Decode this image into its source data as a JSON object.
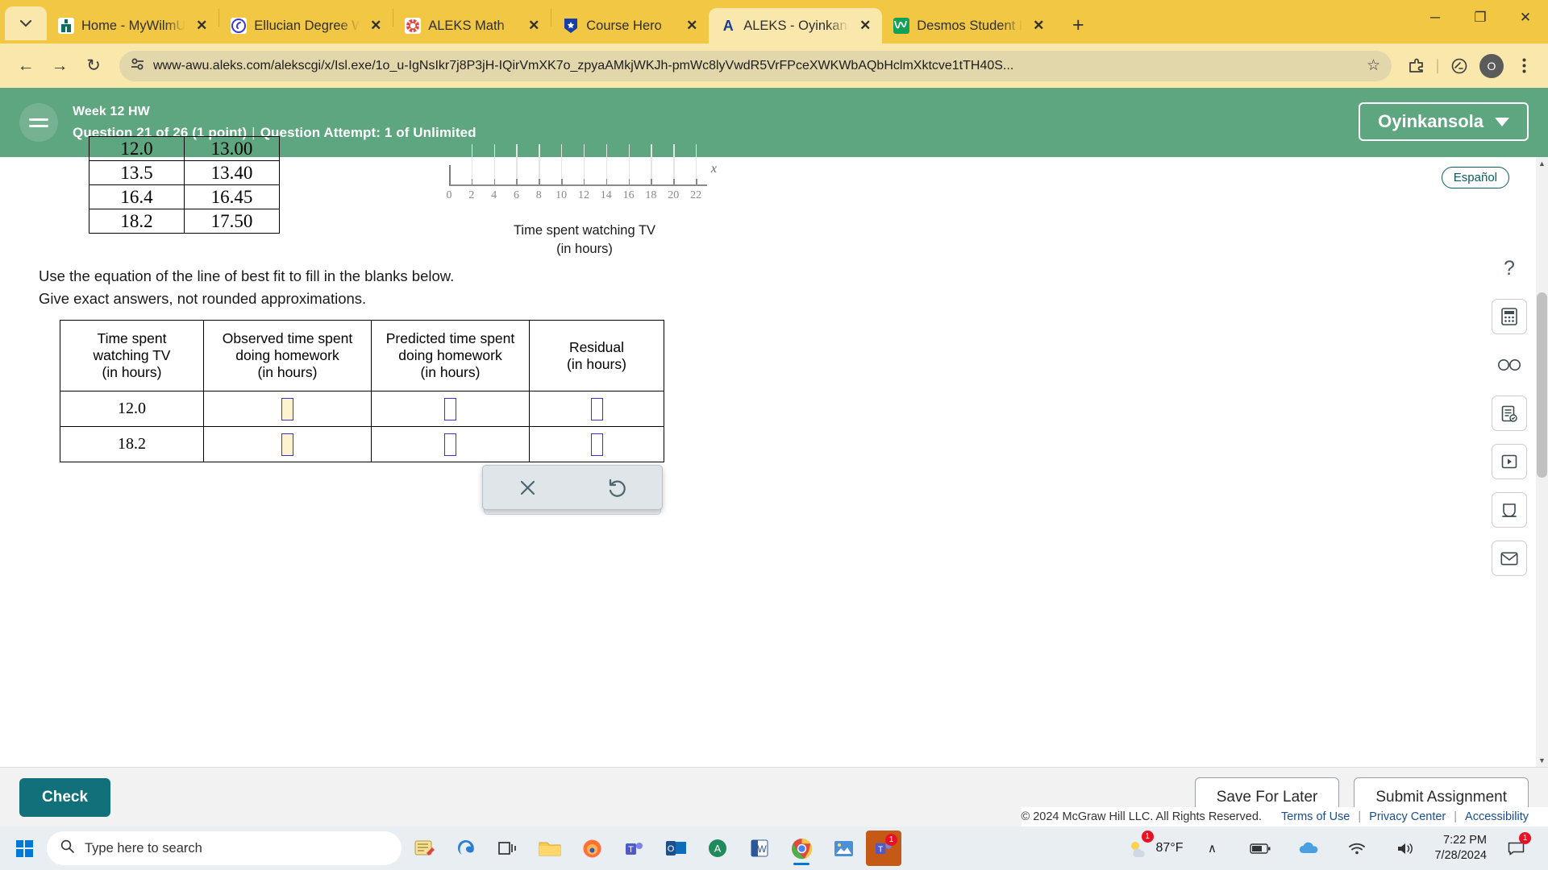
{
  "browser": {
    "tabs": [
      {
        "title": "Home - MyWilmU",
        "icon": "mywilmu-favicon",
        "active": false
      },
      {
        "title": "Ellucian Degree W",
        "icon": "ellucian-favicon",
        "active": false
      },
      {
        "title": "ALEKS Math",
        "icon": "aleks-math-favicon",
        "active": false
      },
      {
        "title": "Course Hero",
        "icon": "course-hero-favicon",
        "active": false
      },
      {
        "title": "ALEKS - Oyinkanso",
        "icon": "aleks-favicon",
        "active": true
      },
      {
        "title": "Desmos Student D",
        "icon": "desmos-favicon",
        "active": false
      }
    ],
    "new_tab_label": "+",
    "window_controls": {
      "minimize": "─",
      "maximize": "❐",
      "close": "✕"
    },
    "nav": {
      "back": "←",
      "forward": "→",
      "reload": "↻"
    },
    "url": "www-awu.aleks.com/alekscgi/x/Isl.exe/1o_u-IgNsIkr7j8P3jH-IQirVmXK7o_zpyaAMkjWKJh-pmWc8lyVwdR5VrFPceXWKWbAQbHclmXktcve1tTH40S...",
    "bookmark_icon": "☆",
    "profile_initial": "O"
  },
  "aleks": {
    "assignment_title": "Week 12 HW",
    "question_status": "Question 21 of 26 (1 point)",
    "attempt_status": "Question Attempt: 1 of Unlimited",
    "user_name": "Oyinkansola",
    "language_button": "Español",
    "prompt_line1": "Use the equation of the line of best fit to fill in the blanks below.",
    "prompt_line2": "Give exact answers, not rounded approximations.",
    "data_table": {
      "rows": [
        [
          "12.0",
          "13.00"
        ],
        [
          "13.5",
          "13.40"
        ],
        [
          "16.4",
          "16.45"
        ],
        [
          "18.2",
          "17.50"
        ]
      ]
    },
    "answer_table": {
      "headers": [
        "Time spent\nwatching TV\n(in hours)",
        "Observed time spent\ndoing homework\n(in hours)",
        "Predicted time spent\ndoing homework\n(in hours)",
        "Residual\n(in hours)"
      ],
      "header_lines": [
        [
          "Time spent",
          "watching TV",
          "(in hours)"
        ],
        [
          "Observed time spent",
          "doing homework",
          "(in hours)"
        ],
        [
          "Predicted time spent",
          "doing homework",
          "(in hours)"
        ],
        [
          "Residual",
          "(in hours)"
        ]
      ],
      "rows": [
        {
          "tv": "12.0",
          "observed": "",
          "predicted": "",
          "residual": ""
        },
        {
          "tv": "18.2",
          "observed": "",
          "predicted": "",
          "residual": ""
        }
      ]
    },
    "math_popup": {
      "clear_icon": "✕",
      "undo_icon": "↺"
    },
    "tool_rail": [
      {
        "name": "help-icon",
        "glyph": "?"
      },
      {
        "name": "calculator-icon",
        "glyph": "⌨"
      },
      {
        "name": "glasses-icon",
        "glyph": "∞"
      },
      {
        "name": "notes-icon",
        "glyph": "☑"
      },
      {
        "name": "video-icon",
        "glyph": "▶"
      },
      {
        "name": "keyboard-icon",
        "glyph": "⌨"
      },
      {
        "name": "mail-icon",
        "glyph": "✉"
      }
    ],
    "footer": {
      "check": "Check",
      "save_for_later": "Save For Later",
      "submit_assignment": "Submit Assignment"
    },
    "legal": {
      "copyright": "© 2024 McGraw Hill LLC. All Rights Reserved.",
      "terms": "Terms of Use",
      "privacy": "Privacy Center",
      "accessibility": "Accessibility",
      "separator": "|"
    }
  },
  "chart_data": {
    "type": "scatter",
    "title": "",
    "xlabel_line1": "Time spent watching TV",
    "xlabel_line2": "(in hours)",
    "axis_variable": "x",
    "xlim": [
      0,
      23
    ],
    "xticks": [
      0,
      2,
      4,
      6,
      8,
      10,
      12,
      14,
      16,
      18,
      20,
      22
    ],
    "xticklabels": [
      "0",
      "2",
      "4",
      "6",
      "8",
      "10",
      "12",
      "14",
      "16",
      "18",
      "20",
      "22"
    ],
    "grid": true,
    "legend": "none",
    "points": []
  },
  "taskbar": {
    "search_placeholder": "Type here to search",
    "search_icon": "search-icon",
    "apps": [
      {
        "name": "task-view-icon"
      },
      {
        "name": "file-explorer-icon"
      },
      {
        "name": "firefox-icon"
      },
      {
        "name": "teams-icon"
      },
      {
        "name": "outlook-icon",
        "badge": ""
      },
      {
        "name": "ancestry-icon"
      },
      {
        "name": "word-icon"
      },
      {
        "name": "chrome-icon"
      },
      {
        "name": "photos-icon"
      },
      {
        "name": "teams-2-icon",
        "badge": "1"
      }
    ],
    "weather": {
      "temperature": "87°F",
      "badge": "1"
    },
    "time": "7:22 PM",
    "date": "7/28/2024",
    "notification_badge": "1",
    "chevron_icon": "∧"
  },
  "colors": {
    "browser_frame": "#f2c744",
    "tab_active": "#fae7ab",
    "aleks_green": "#5ea67f",
    "check_teal": "#11707a",
    "input_border": "#3b30d6",
    "input_fill": "#fdf4cf"
  }
}
